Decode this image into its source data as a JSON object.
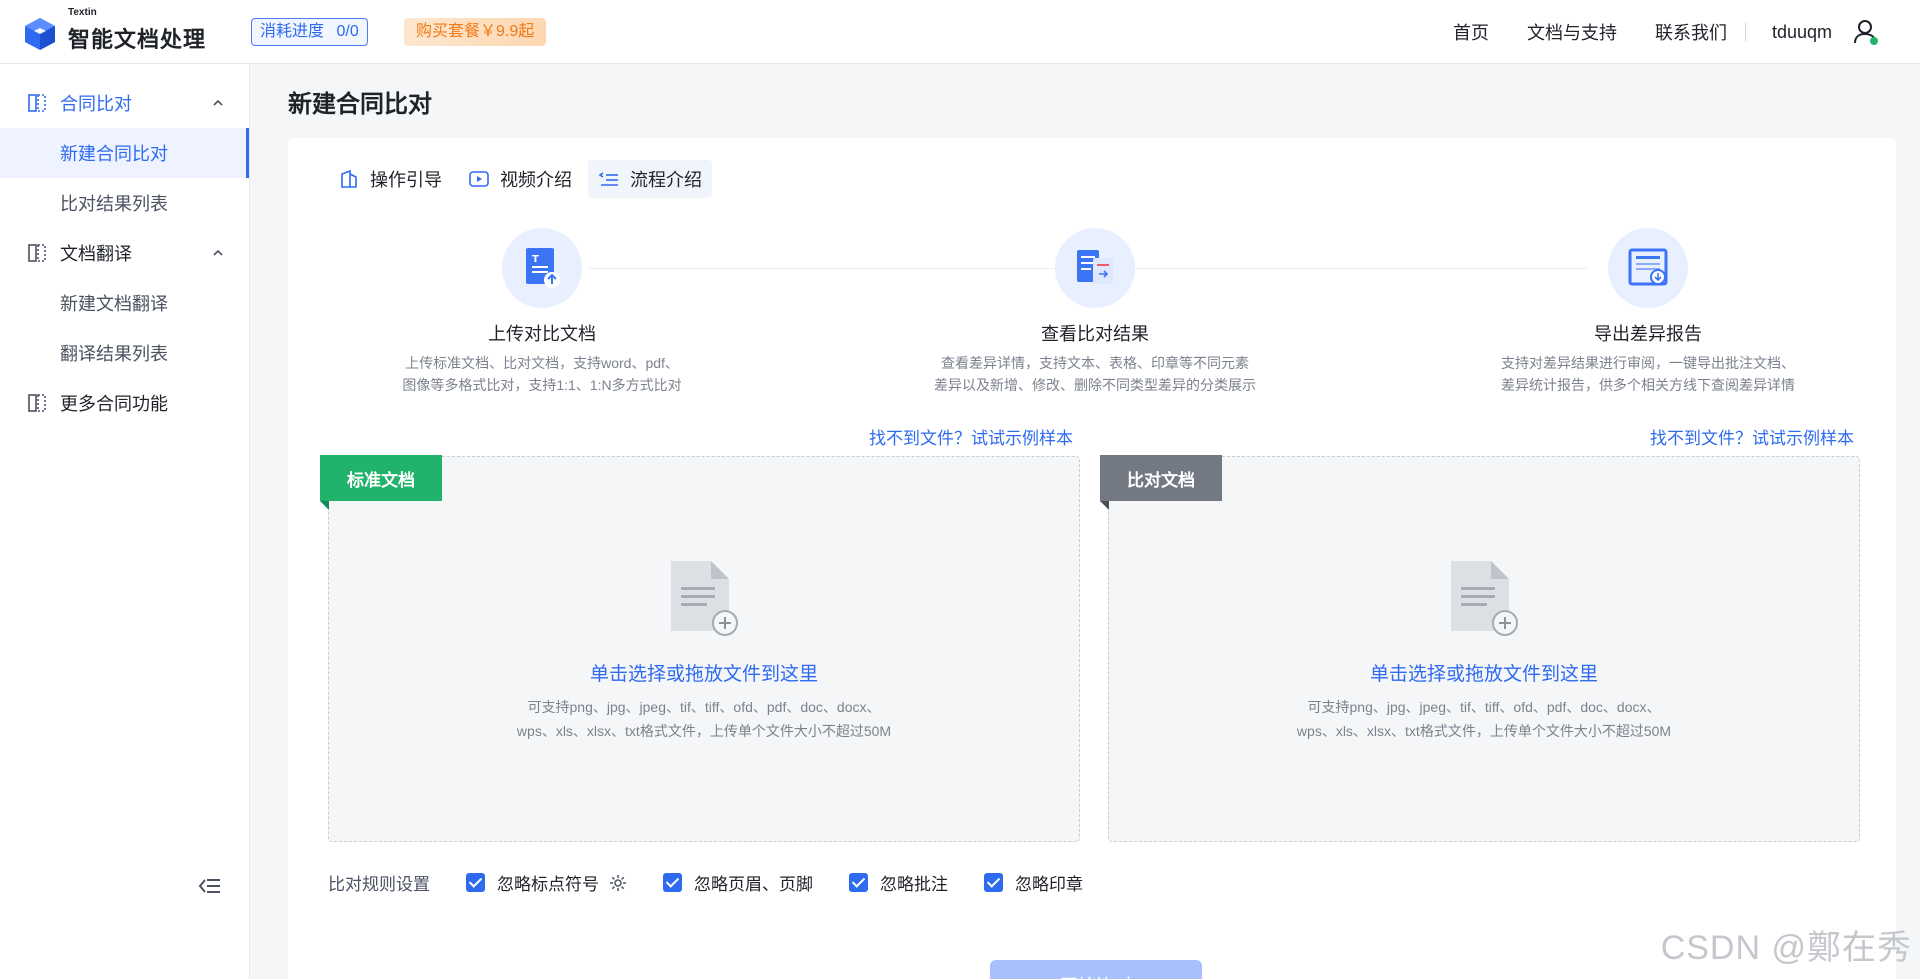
{
  "header": {
    "logo_small": "Textin",
    "logo_title": "智能文档处理",
    "usage_label": "消耗进度",
    "usage_value": "0/0",
    "buy_label": "购买套餐￥9.9起",
    "nav": [
      "首页",
      "文档与支持",
      "联系我们"
    ],
    "username": "tduuqm"
  },
  "sidebar": {
    "groups": [
      {
        "label": "合同比对",
        "items": [
          "新建合同比对",
          "比对结果列表"
        ]
      },
      {
        "label": "文档翻译",
        "items": [
          "新建文档翻译",
          "翻译结果列表"
        ]
      },
      {
        "label": "更多合同功能"
      }
    ]
  },
  "page_title": "新建合同比对",
  "tabs": [
    "操作引导",
    "视频介绍",
    "流程介绍"
  ],
  "steps": [
    {
      "title": "上传对比文档",
      "desc1": "上传标准文档、比对文档，支持word、pdf、",
      "desc2": "图像等多格式比对，支持1:1、1:N多方式比对"
    },
    {
      "title": "查看比对结果",
      "desc1": "查看差异详情，支持文本、表格、印章等不同元素",
      "desc2": "差异以及新增、修改、删除不同类型差异的分类展示"
    },
    {
      "title": "导出差异报告",
      "desc1": "支持对差异结果进行审阅，一键导出批注文档、",
      "desc2": "差异统计报告，供多个相关方线下查阅差异详情"
    }
  ],
  "sample_link": "找不到文件？试试示例样本",
  "zones": [
    {
      "tag": "标准文档",
      "main": "单击选择或拖放文件到这里",
      "sub1": "可支持png、jpg、jpeg、tif、tiff、ofd、pdf、doc、docx、",
      "sub2": "wps、xls、xlsx、txt格式文件，上传单个文件大小不超过50M"
    },
    {
      "tag": "比对文档",
      "main": "单击选择或拖放文件到这里",
      "sub1": "可支持png、jpg、jpeg、tif、tiff、ofd、pdf、doc、docx、",
      "sub2": "wps、xls、xlsx、txt格式文件，上传单个文件大小不超过50M"
    }
  ],
  "rules": {
    "label": "比对规则设置",
    "options": [
      "忽略标点符号",
      "忽略页眉、页脚",
      "忽略批注",
      "忽略印章"
    ]
  },
  "submit_label": "开始比对",
  "watermark": "CSDN @鄭在秀",
  "colors": {
    "primary": "#2f6bf0",
    "green_tag": "#21b26b",
    "gray_tag": "#737983",
    "buy_text": "#f07b19"
  }
}
